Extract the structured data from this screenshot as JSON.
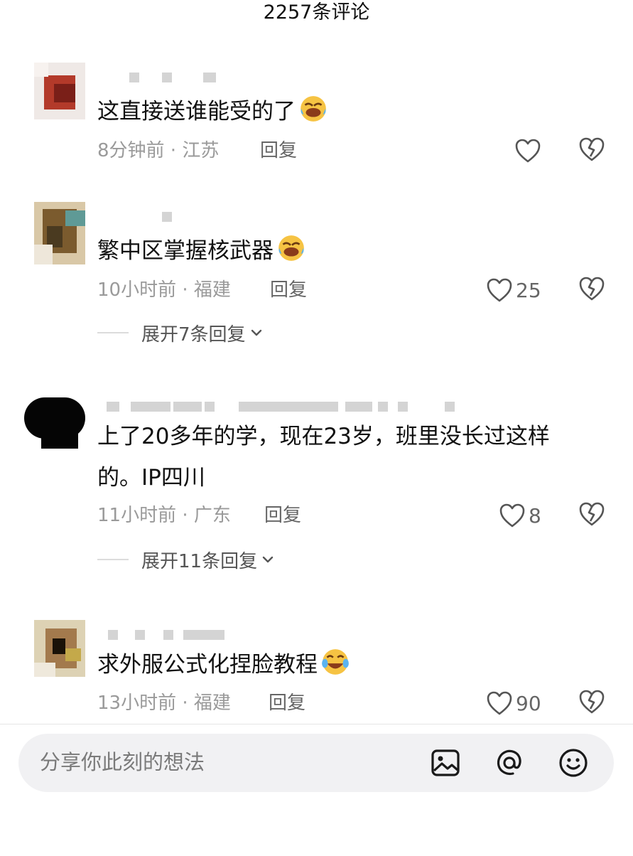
{
  "header": {
    "title": "2257条评论"
  },
  "comments": [
    {
      "text": "这直接送谁能受的了",
      "time_location": "8分钟前 · 江苏",
      "reply_label": "回复",
      "likes": "",
      "expand": ""
    },
    {
      "text": "繁中区掌握核武器",
      "time_location": "10小时前 · 福建",
      "reply_label": "回复",
      "likes": "25",
      "expand": "展开7条回复"
    },
    {
      "text": "上了20多年的学，现在23岁，班里没长过这样的。IP四川",
      "time_location": "11小时前 · 广东",
      "reply_label": "回复",
      "likes": "8",
      "expand": "展开11条回复"
    },
    {
      "text": "求外服公式化捏脸教程",
      "time_location": "13小时前 · 福建",
      "reply_label": "回复",
      "likes": "90",
      "expand": ""
    }
  ],
  "composer": {
    "placeholder": "分享你此刻的想法",
    "icons": [
      "image-icon",
      "at-icon",
      "emoji-icon"
    ]
  },
  "colors": {
    "text": "#111111",
    "meta": "#9a9a9a",
    "input_bg": "#f1f1f3",
    "emoji_face": "#f6c343"
  }
}
